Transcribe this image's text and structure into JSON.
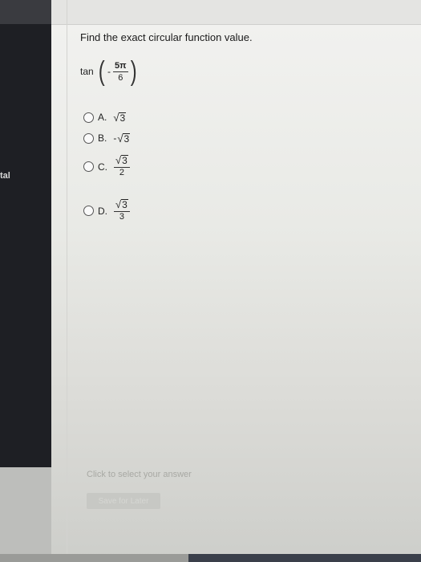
{
  "sidebar": {
    "partial_label": "tal"
  },
  "question": {
    "prompt": "Find the exact circular function value.",
    "func": "tan",
    "sign": "-",
    "numerator": "5π",
    "denominator": "6"
  },
  "options": [
    {
      "letter": "A.",
      "sign": "",
      "radicand": "3",
      "denominator": ""
    },
    {
      "letter": "B.",
      "sign": "-",
      "radicand": "3",
      "denominator": ""
    },
    {
      "letter": "C.",
      "sign": "",
      "radicand": "3",
      "denominator": "2"
    },
    {
      "letter": "D.",
      "sign": "",
      "radicand": "3",
      "denominator": "3"
    }
  ],
  "footer": {
    "instruction": "Click to select your answer",
    "save_label": "Save for Later"
  }
}
